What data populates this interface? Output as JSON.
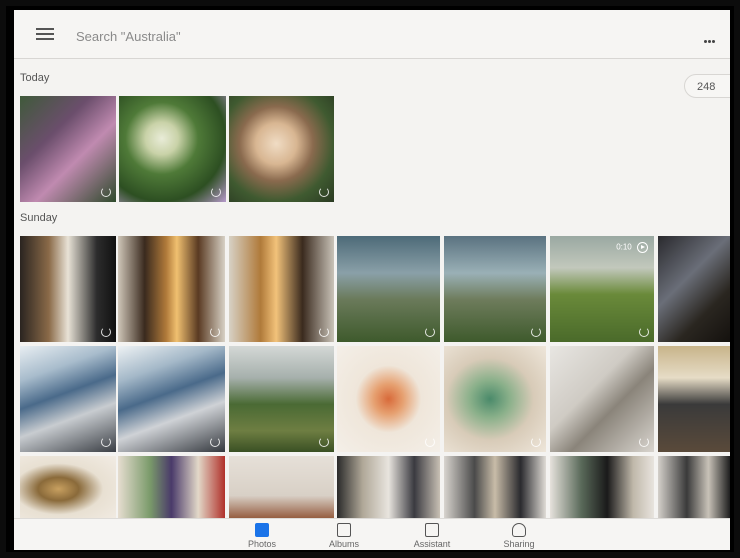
{
  "search": {
    "placeholder": "Search \"Australia\""
  },
  "sections": [
    {
      "label": "Today"
    },
    {
      "label": "Sunday"
    }
  ],
  "photo_count": "248",
  "video_duration": "0:10",
  "bottom_nav": [
    {
      "label": "Photos",
      "icon": "photos-icon"
    },
    {
      "label": "Albums",
      "icon": "albums-icon"
    },
    {
      "label": "Assistant",
      "icon": "assistant-icon"
    },
    {
      "label": "Sharing",
      "icon": "sharing-icon"
    }
  ],
  "colors": {
    "accent": "#1a73e8",
    "background": "#f4f3f1"
  }
}
